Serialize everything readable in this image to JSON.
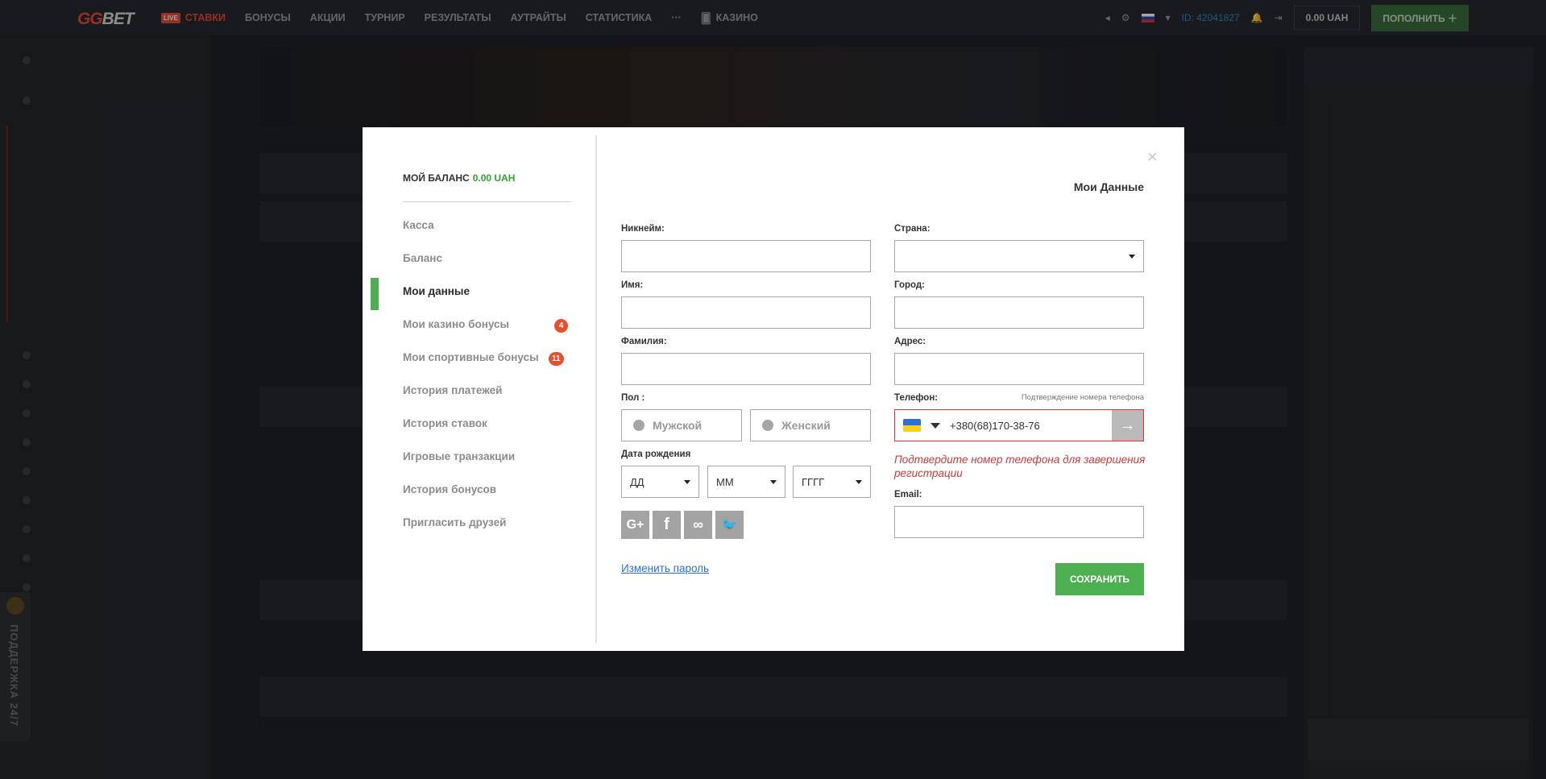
{
  "header": {
    "logo_gg": "GG",
    "logo_bet": "BET",
    "live_badge": "LIVE",
    "nav": [
      "СТАВКИ",
      "БОНУСЫ",
      "АКЦИИ",
      "ТУРНИР",
      "РЕЗУЛЬТАТЫ",
      "АУТРАЙТЫ",
      "СТАТИСТИКА",
      "···",
      "КАЗИНО"
    ],
    "user_id": "ID: 42041827",
    "balance": "0.00 UAH",
    "deposit_label": "ПОПОЛНИТЬ"
  },
  "support_label": "ПОДДЕРЖКА 24/7",
  "modal": {
    "close": "×",
    "balance_label": "МОЙ БАЛАНС",
    "balance_value": "0.00 UAH",
    "menu": [
      "Касса",
      "Баланс",
      "Мои данные",
      "Мои казино бонусы",
      "Мои спортивные бонусы",
      "История платежей",
      "История ставок",
      "Игровые транзакции",
      "История бонусов",
      "Пригласить друзей"
    ],
    "active_menu_index": 2,
    "casino_bonus_count": "4",
    "sport_bonus_count": "11",
    "title": "Мои Данные",
    "labels": {
      "nickname": "Никнейм:",
      "first_name": "Имя:",
      "last_name": "Фамилия:",
      "gender": "Пол :",
      "birthdate": "Дата рождения",
      "country": "Страна:",
      "city": "Город:",
      "address": "Адрес:",
      "phone": "Телефон:",
      "email": "Email:"
    },
    "gender_options": [
      "Мужской",
      "Женский"
    ],
    "birth_placeholders": [
      "ДД",
      "ММ",
      "ГГГГ"
    ],
    "phone_confirm_link": "Подтверждение номера телефона",
    "phone_value": "+380(68)170-38-76",
    "phone_go": "→",
    "phone_error": "Подтвердите номер телефона для завершения регистрации",
    "change_password": "Изменить пароль",
    "save_label": "СОХРАНИТЬ",
    "social_icons": [
      "G+",
      "f",
      "∞",
      "🐦"
    ]
  }
}
